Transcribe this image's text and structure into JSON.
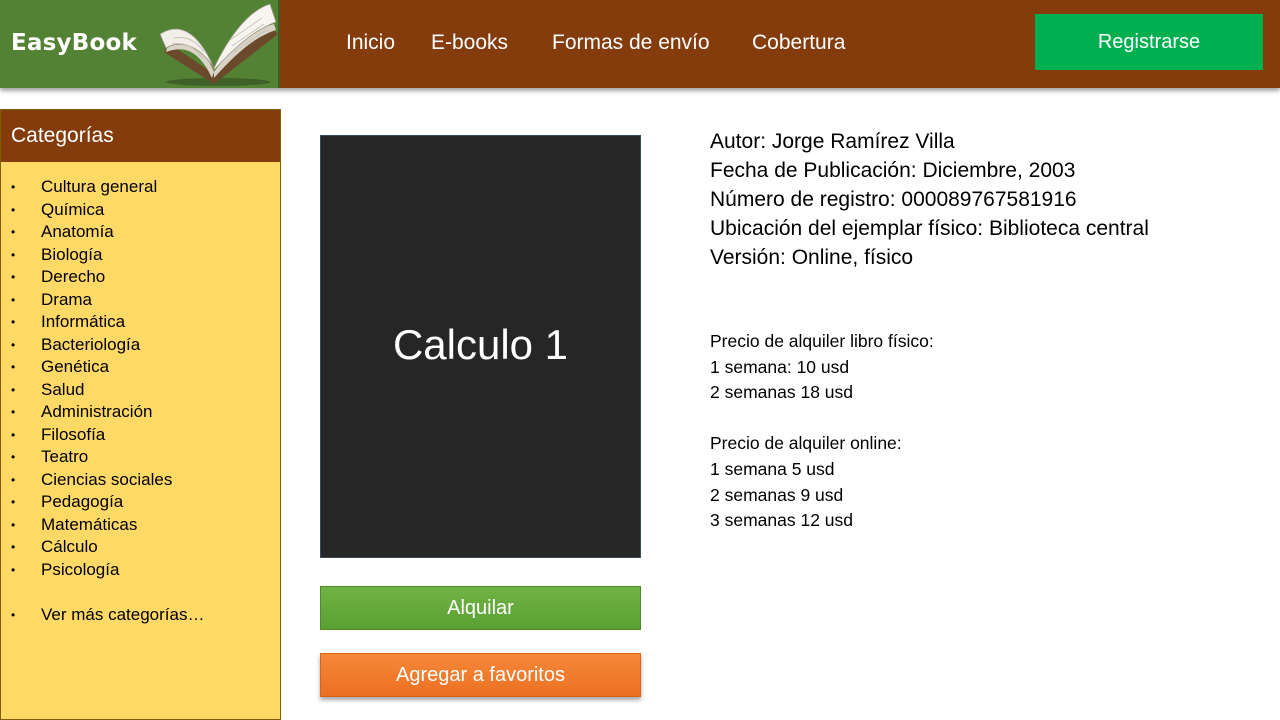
{
  "header": {
    "logo_text": "EasyBook",
    "logo_icon": "open-book-icon",
    "nav": [
      {
        "label": "Inicio"
      },
      {
        "label": "E-books"
      },
      {
        "label": "Formas de envío"
      },
      {
        "label": "Cobertura"
      }
    ],
    "register_label": "Registrarse"
  },
  "sidebar": {
    "title": "Categorías",
    "bullet": "•",
    "categories": [
      "Cultura general",
      "Química",
      "Anatomía",
      "Biología",
      "Derecho",
      "Drama",
      "Informática",
      "Bacteriología",
      "Genética",
      "Salud",
      "Administración",
      "Filosofía",
      "Teatro",
      "Ciencias sociales",
      "Pedagogía",
      "Matemáticas",
      "Cálculo",
      "Psicología"
    ],
    "more_label": "Ver más categorías…"
  },
  "book": {
    "cover_title": "Calculo 1",
    "rent_label": "Alquilar",
    "favorite_label": "Agregar a favoritos",
    "details": [
      "Autor: Jorge Ramírez Villa",
      "Fecha de Publicación: Diciembre, 2003",
      "Número de registro: 000089767581916",
      "Ubicación del ejemplar físico: Biblioteca central",
      "Versión: Online, físico"
    ],
    "physical_prices": {
      "title": "Precio de alquiler libro físico:",
      "lines": [
        "1 semana: 10 usd",
        "2 semanas 18 usd"
      ]
    },
    "online_prices": {
      "title": "Precio de alquiler online:",
      "lines": [
        "1 semana 5 usd",
        "2 semanas 9 usd",
        "3 semanas 12 usd"
      ]
    }
  },
  "colors": {
    "header_brown": "#843c0c",
    "logo_green": "#548235",
    "register_green": "#00b050",
    "sidebar_yellow": "#ffd966",
    "cover_dark": "#262626",
    "rent_green": "#5ba033",
    "favorite_orange": "#ec7021"
  }
}
